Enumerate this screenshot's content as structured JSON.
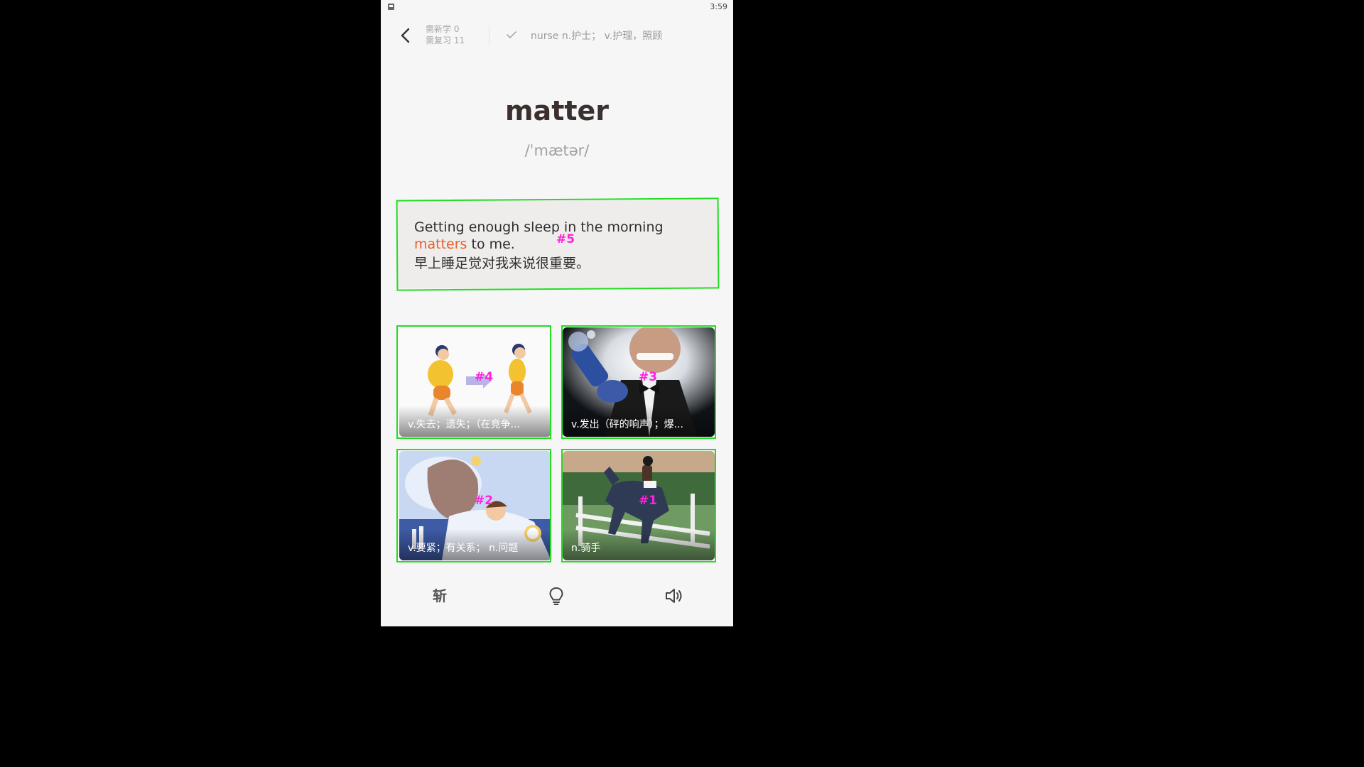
{
  "status_bar": {
    "time": "3:59"
  },
  "header": {
    "new_count": "需新学 0",
    "review_count": "需复习 11",
    "prev_word": "nurse n.护士； v.护理，照顾"
  },
  "word": {
    "text": "matter",
    "phonetic": "/ˈmætər/"
  },
  "sentence": {
    "en_before": "Getting enough sleep in the morning",
    "en_highlight": "matters",
    "en_after": " to me.",
    "cn": "早上睡足觉对我来说很重要。"
  },
  "options": [
    {
      "caption": "v.失去；遗失；（在竞争...",
      "marker": "#4"
    },
    {
      "caption": "v.发出（砰的响声）；爆...",
      "marker": "#3"
    },
    {
      "caption": "v.要紧；有关系； n.问题",
      "marker": "#2"
    },
    {
      "caption": "n.骑手",
      "marker": "#1"
    }
  ],
  "sentence_marker": "#5",
  "bottom_bar": {
    "cut_label": "斩",
    "hint_icon": "lightbulb-icon",
    "sound_icon": "speaker-icon"
  },
  "colors": {
    "highlight": "#e85d2a",
    "marker_box": "#22dd22",
    "marker_label": "#ff22dd"
  }
}
